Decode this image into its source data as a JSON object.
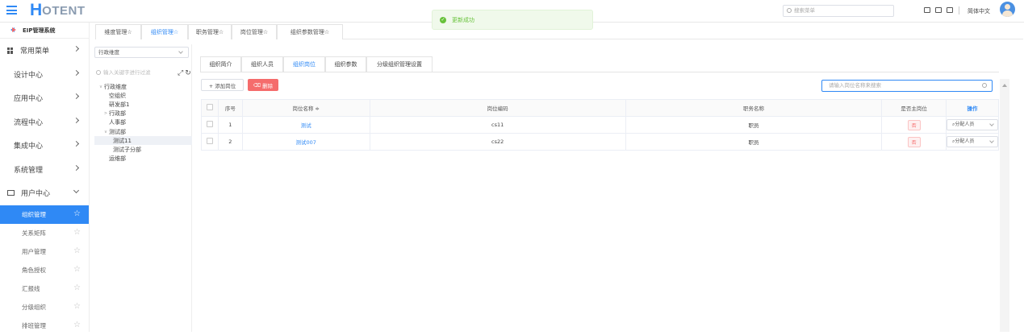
{
  "header": {
    "logo_mark": "H",
    "logo_text": "OTENT",
    "toast": "更新成功",
    "search_placeholder": "搜索菜单",
    "language": "简体中文"
  },
  "sidebar": {
    "system_title": "EIP管理系统",
    "items": [
      {
        "label": "常用菜单"
      },
      {
        "label": "设计中心"
      },
      {
        "label": "应用中心"
      },
      {
        "label": "流程中心"
      },
      {
        "label": "集成中心"
      },
      {
        "label": "系统管理"
      },
      {
        "label": "用户中心"
      }
    ],
    "sub_items": [
      {
        "label": "组织管理",
        "active": true
      },
      {
        "label": "关系矩阵"
      },
      {
        "label": "用户管理"
      },
      {
        "label": "角色授权"
      },
      {
        "label": "汇报线"
      },
      {
        "label": "分级组织"
      },
      {
        "label": "排班管理"
      }
    ]
  },
  "top_tabs": [
    {
      "label": "维度管理☆"
    },
    {
      "label": "组织管理☆",
      "active": true
    },
    {
      "label": "职务管理☆"
    },
    {
      "label": "岗位管理☆"
    },
    {
      "label": "组织参数管理☆"
    }
  ],
  "left_panel": {
    "dimension": "行政维度",
    "filter_placeholder": "输入关键字进行过滤",
    "tree": [
      {
        "label": "行政维度",
        "level": 0,
        "toggle": "v"
      },
      {
        "label": "空组织",
        "level": 1
      },
      {
        "label": "研发部1",
        "level": 1
      },
      {
        "label": "行政部",
        "level": 1,
        "toggle": ">"
      },
      {
        "label": "人事部",
        "level": 1
      },
      {
        "label": "测试部",
        "level": 1,
        "toggle": "v"
      },
      {
        "label": "测试11",
        "level": 2,
        "selected": true
      },
      {
        "label": "测试子分部",
        "level": 2
      },
      {
        "label": "运维部",
        "level": 1
      }
    ]
  },
  "inner_tabs": [
    {
      "label": "组织简介"
    },
    {
      "label": "组织人员"
    },
    {
      "label": "组织岗位",
      "active": true
    },
    {
      "label": "组织参数"
    },
    {
      "label": "分级组织管理设置"
    }
  ],
  "toolbar": {
    "add_label": "+ 添加岗位",
    "delete_label": "删除",
    "search_placeholder": "请输入岗位名称来搜索"
  },
  "table": {
    "columns": [
      "序号",
      "岗位名称 ≑",
      "岗位编码",
      "职务名称",
      "是否主岗位",
      "操作"
    ],
    "rows": [
      {
        "index": "1",
        "name": "测试",
        "code": "cs11",
        "job": "职员",
        "is_main": "否",
        "action": "分配人员"
      },
      {
        "index": "2",
        "name": "测试007",
        "code": "cs22",
        "job": "职员",
        "is_main": "否",
        "action": "分配人员"
      }
    ]
  }
}
